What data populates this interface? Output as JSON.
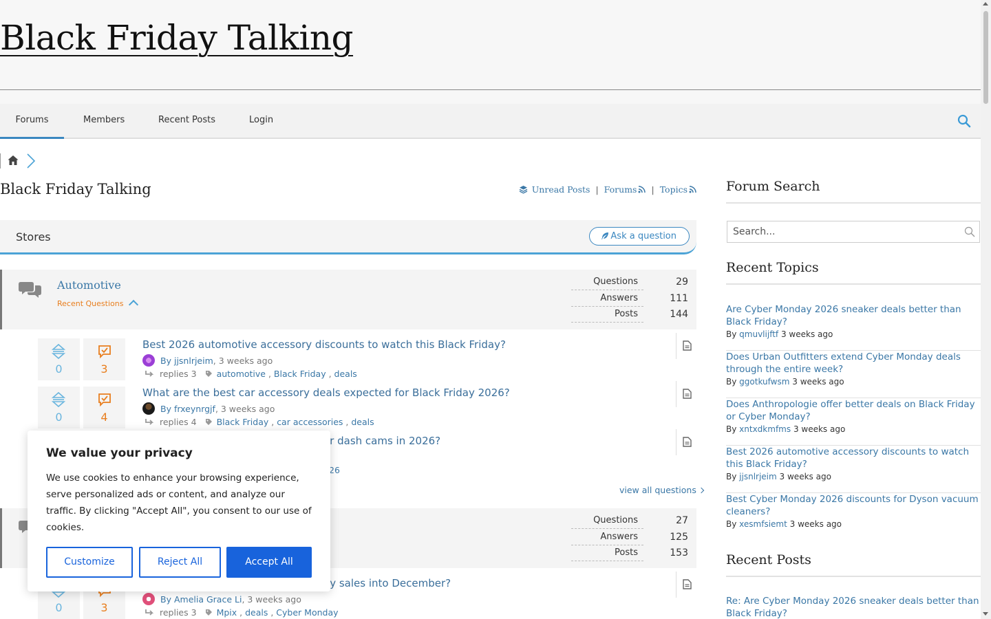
{
  "site": {
    "title": "Black Friday Talking"
  },
  "nav": {
    "items": [
      "Forums",
      "Members",
      "Recent Posts",
      "Login"
    ]
  },
  "forum": {
    "heading": "Black Friday Talking",
    "feeds": {
      "unread": "Unread Posts",
      "forums": "Forums",
      "topics": "Topics"
    },
    "section": "Stores",
    "ask_label": "Ask a question",
    "view_all": "view all questions"
  },
  "categories": [
    {
      "name": "Automotive",
      "recent_label": "Recent Questions",
      "stats": [
        {
          "label": "Questions",
          "value": "29"
        },
        {
          "label": "Answers",
          "value": "111"
        },
        {
          "label": "Posts",
          "value": "144"
        }
      ]
    },
    {
      "name": "",
      "recent_label": "",
      "stats": [
        {
          "label": "Questions",
          "value": "27"
        },
        {
          "label": "Answers",
          "value": "125"
        },
        {
          "label": "Posts",
          "value": "153"
        }
      ]
    }
  ],
  "questions": [
    {
      "title": "Best 2026 automotive accessory discounts to watch this Black Friday?",
      "votes": "0",
      "answers": "3",
      "by": "By",
      "author": "jjsnlrjeim",
      "time": ", 3 weeks ago",
      "replies": "replies 3",
      "tags": [
        "automotive",
        "Black Friday",
        "deals"
      ],
      "avatar_color": "#9b3fd6"
    },
    {
      "title": "What are the best car accessory deals expected for Black Friday 2026?",
      "votes": "0",
      "answers": "4",
      "by": "By",
      "author": "frxeynrgjf",
      "time": ", 3 weeks ago",
      "replies": "replies 4",
      "tags": [
        "Black Friday",
        "car accessories",
        "deals"
      ],
      "avatar_color": "#222222"
    },
    {
      "title": "or dash cams in 2026?",
      "tail": "26"
    },
    {
      "title": "ay sales into December?",
      "votes": "0",
      "answers": "3",
      "by": "By",
      "author": "Amelia Grace Li",
      "time": ", 3 weeks ago",
      "replies": "replies 3",
      "tags": [
        "Mpix",
        "deals",
        "Cyber Monday"
      ],
      "avatar_color": "#e0507a"
    }
  ],
  "sidebar": {
    "search_heading": "Forum Search",
    "search_placeholder": "Search...",
    "recent_topics_heading": "Recent Topics",
    "recent_topics": [
      {
        "title": "Are Cyber Monday 2026 sneaker deals better than Black Friday?",
        "by": "By",
        "author": "qmuvlijftf",
        "time": "3 weeks ago"
      },
      {
        "title": "Does Urban Outfitters extend Cyber Monday deals through the entire week?",
        "by": "By",
        "author": "ggotkufwsm",
        "time": "3 weeks ago"
      },
      {
        "title": "Does Anthropologie offer better deals on Black Friday or Cyber Monday?",
        "by": "By",
        "author": "xntxdkmfms",
        "time": "3 weeks ago"
      },
      {
        "title": "Best 2026 automotive accessory discounts to watch this Black Friday?",
        "by": "By",
        "author": "jjsnlrjeim",
        "time": "3 weeks ago"
      },
      {
        "title": "Best Cyber Monday 2026 discounts for Dyson vacuum cleaners?",
        "by": "By",
        "author": "xesmfsiemt",
        "time": "3 weeks ago"
      }
    ],
    "recent_posts_heading": "Recent Posts",
    "recent_posts": [
      {
        "title": "Re: Are Cyber Monday 2026 sneaker deals better than Black Friday?"
      }
    ]
  },
  "cookie": {
    "title": "We value your privacy",
    "text": "We use cookies to enhance your browsing experience, serve personalized ads or content, and analyze our traffic. By clicking \"Accept All\", you consent to our use of cookies.",
    "customize": "Customize",
    "reject": "Reject All",
    "accept": "Accept All"
  },
  "colors": {
    "accent": "#3a87c0",
    "link": "#3a77a6",
    "orange": "#e87e1e",
    "cookie_blue": "#1863dc"
  }
}
